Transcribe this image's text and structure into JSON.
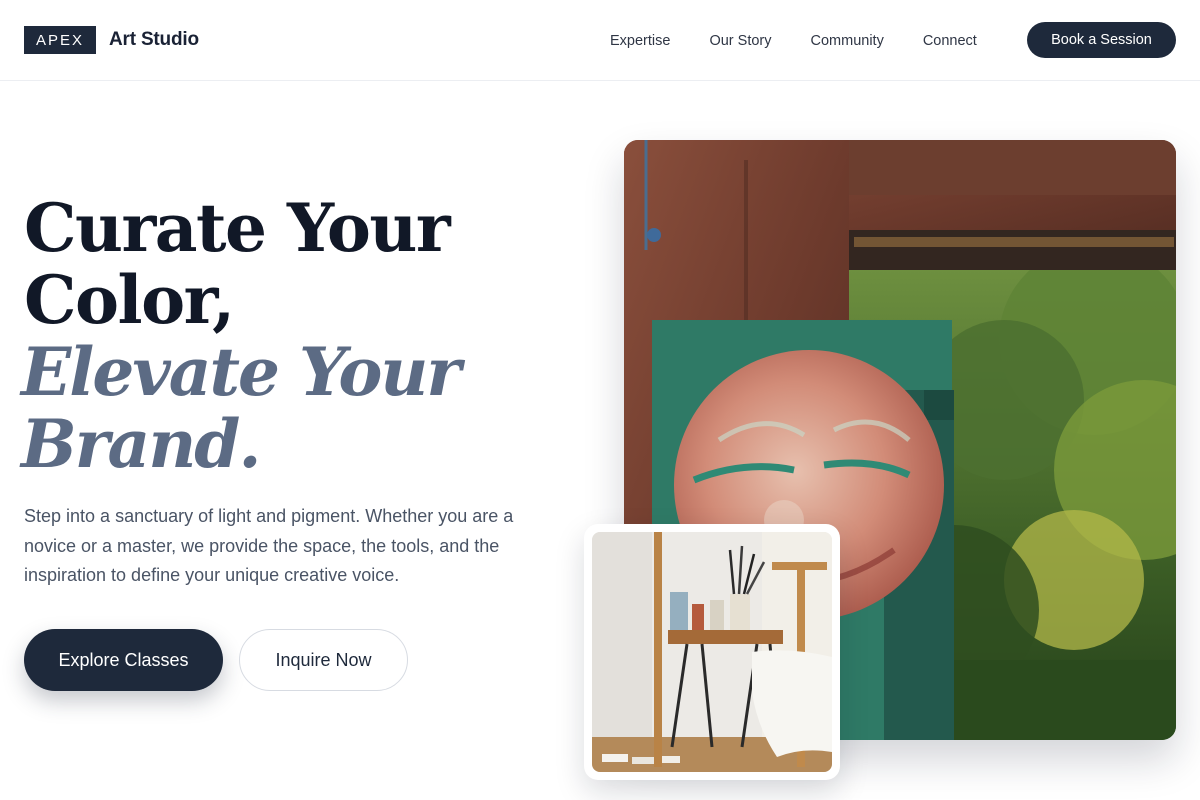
{
  "brand": {
    "badge": "APEX",
    "name": "Art Studio"
  },
  "nav": {
    "links": [
      "Expertise",
      "Our Story",
      "Community",
      "Connect"
    ],
    "cta_label": "Book a Session"
  },
  "hero": {
    "headline_dark": [
      "Curate Your",
      "Color,"
    ],
    "headline_muted": [
      "Elevate Your",
      "Brand."
    ],
    "description": "Step into a sanctuary of light and pigment. Whether you are a novice or a master, we provide the space, the tools, and the inspiration to define your unique creative voice.",
    "primary_button": "Explore Classes",
    "secondary_button": "Inquire Now"
  },
  "colors": {
    "navy": "#1e293b",
    "muted_slate": "#5c6b84",
    "text_gray": "#4a5465"
  },
  "images": {
    "main": "painted-canvas-in-garden-photo",
    "inset": "artist-easel-and-brushes-photo"
  }
}
